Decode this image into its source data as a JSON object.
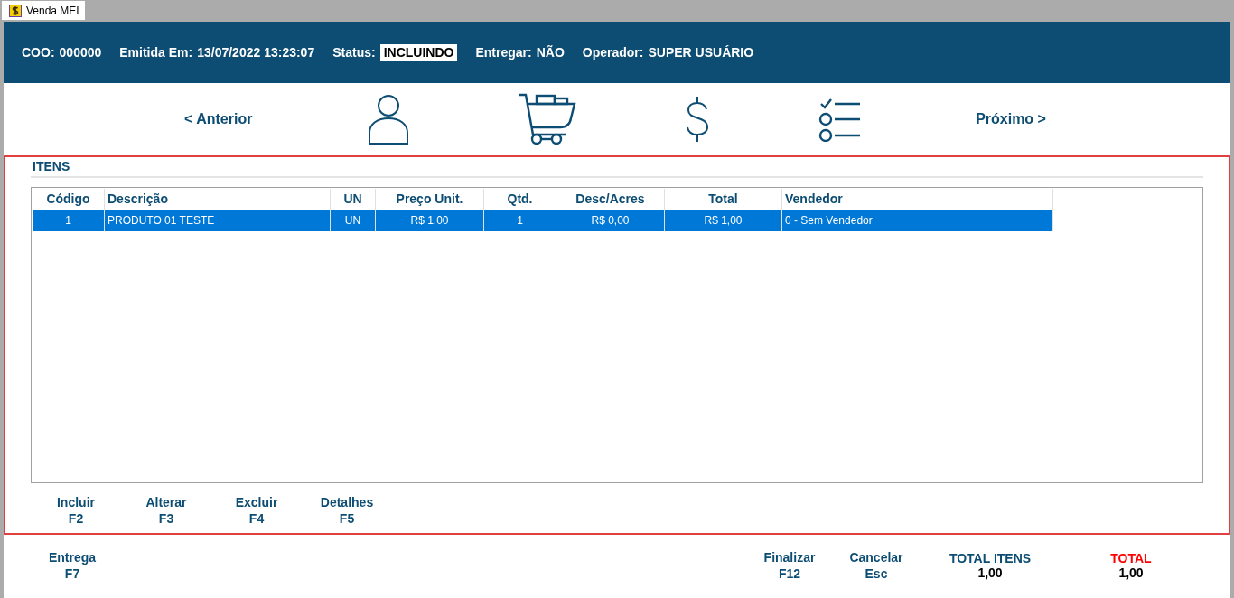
{
  "window": {
    "tab": "Venda MEI"
  },
  "header": [
    {
      "label": "COO:",
      "value": "000000",
      "kind": "text"
    },
    {
      "label": "Emitida Em:",
      "value": "13/07/2022 13:23:07",
      "kind": "text"
    },
    {
      "label": "Status:",
      "value": "INCLUINDO",
      "kind": "badge"
    },
    {
      "label": "Entregar:",
      "value": "NÃO",
      "kind": "text"
    },
    {
      "label": "Operador:",
      "value": "SUPER USUÁRIO",
      "kind": "text"
    }
  ],
  "nav": {
    "previous": "< Anterior",
    "next": "Próximo >",
    "steps": [
      {
        "kind": "customer"
      },
      {
        "kind": "cart"
      },
      {
        "kind": "payment"
      },
      {
        "kind": "checklist"
      }
    ]
  },
  "items": {
    "title": "ITENS",
    "columns": [
      "Código",
      "Descrição",
      "UN",
      "Preço Unit.",
      "Qtd.",
      "Desc/Acres",
      "Total",
      "Vendedor"
    ],
    "rows": [
      {
        "selected": true,
        "cells": [
          "1",
          "PRODUTO 01 TESTE",
          "UN",
          "R$ 1,00",
          "1",
          "R$ 0,00",
          "R$ 1,00",
          "0 - Sem Vendedor"
        ]
      }
    ],
    "actions": [
      {
        "label": "Incluir",
        "key": "F2"
      },
      {
        "label": "Alterar",
        "key": "F3"
      },
      {
        "label": "Excluir",
        "key": "F4"
      },
      {
        "label": "Detalhes",
        "key": "F5"
      }
    ]
  },
  "footer": {
    "left_actions": [
      {
        "label": "Entrega",
        "key": "F7"
      }
    ],
    "right_actions": [
      {
        "label": "Finalizar",
        "key": "F12"
      },
      {
        "label": "Cancelar",
        "key": "Esc"
      }
    ],
    "totals": [
      {
        "label": "TOTAL ITENS",
        "value": "1,00",
        "color": "#0d4d73"
      },
      {
        "label": "TOTAL",
        "value": "1,00",
        "color": "#ff0000"
      }
    ]
  }
}
